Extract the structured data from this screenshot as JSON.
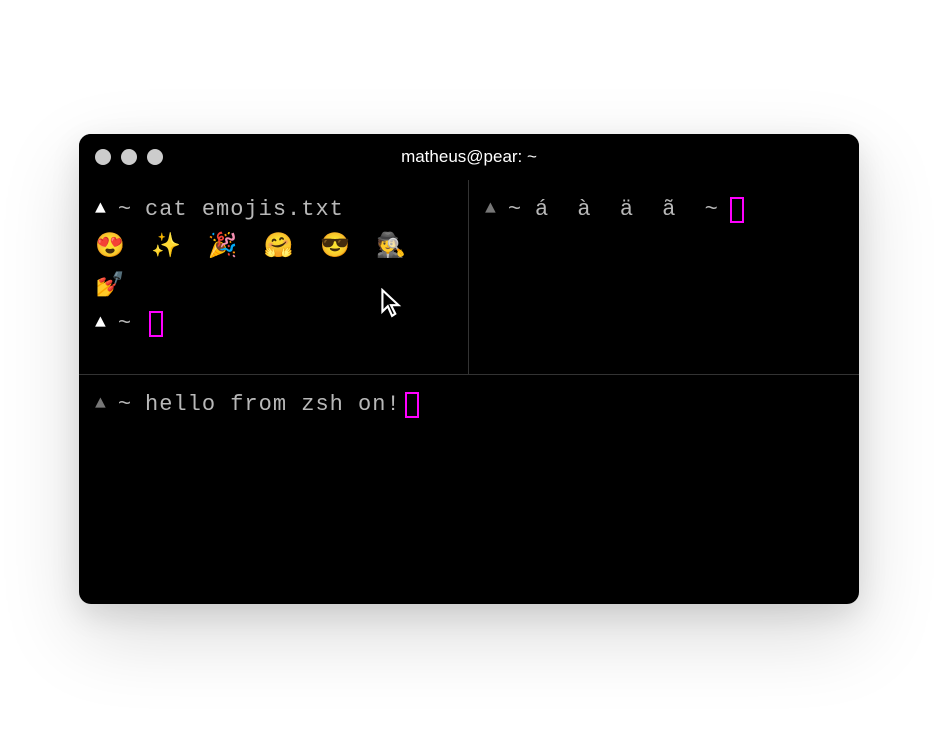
{
  "window": {
    "title": "matheus@pear: ~"
  },
  "panes": {
    "top_left": {
      "prompt_symbol": "▲",
      "prompt_path": "~",
      "command": "cat emojis.txt",
      "output": "😍 ✨ 🎉 🤗 😎 🕵️ 💅",
      "next_prompt_symbol": "▲",
      "next_prompt_path": "~"
    },
    "top_right": {
      "prompt_symbol": "▲",
      "prompt_path": "~",
      "text": "á à ä ã ~"
    },
    "bottom": {
      "prompt_symbol": "▲",
      "prompt_path": "~",
      "text": "hello from zsh on ",
      "apple_icon": "",
      "exclaim": "!"
    }
  },
  "colors": {
    "background": "#000000",
    "text": "#b8b8b8",
    "cursor": "#ff00ff",
    "divider": "#333333"
  }
}
